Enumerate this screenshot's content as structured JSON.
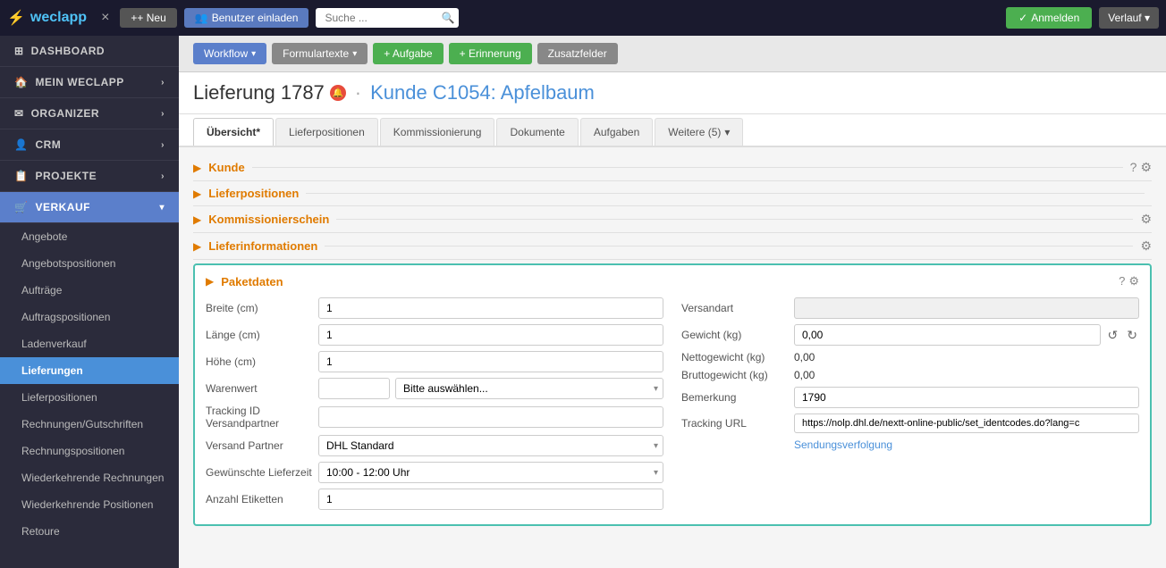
{
  "topnav": {
    "logo": "weclapp",
    "close_label": "×",
    "btn_new": "+ Neu",
    "btn_invite": "Benutzer einladen",
    "search_placeholder": "Suche ...",
    "btn_anmelden": "✓ Anmelden",
    "btn_verlauf": "Verlauf ▾"
  },
  "sidebar": {
    "items": [
      {
        "id": "dashboard",
        "label": "DASHBOARD",
        "icon": "⊞",
        "has_chevron": false
      },
      {
        "id": "mein-weclapp",
        "label": "MEIN WECLAPP",
        "icon": "🏠",
        "has_chevron": true
      },
      {
        "id": "organizer",
        "label": "ORGANIZER",
        "icon": "✉",
        "has_chevron": true
      },
      {
        "id": "crm",
        "label": "CRM",
        "icon": "👤",
        "has_chevron": true
      },
      {
        "id": "projekte",
        "label": "PROJEKTE",
        "icon": "📋",
        "has_chevron": true
      },
      {
        "id": "verkauf",
        "label": "VERKAUF",
        "icon": "🛒",
        "has_chevron": true,
        "active": true
      }
    ],
    "sub_items": [
      {
        "id": "angebote",
        "label": "Angebote"
      },
      {
        "id": "angebotspositionen",
        "label": "Angebotspositionen"
      },
      {
        "id": "auftraege",
        "label": "Aufträge"
      },
      {
        "id": "auftragspositionen",
        "label": "Auftragspositionen"
      },
      {
        "id": "ladenverkauf",
        "label": "Ladenverkauf"
      },
      {
        "id": "lieferungen",
        "label": "Lieferungen",
        "active": true
      },
      {
        "id": "lieferpositionen",
        "label": "Lieferpositionen"
      },
      {
        "id": "rechnungen-gutschriften",
        "label": "Rechnungen/Gutschriften"
      },
      {
        "id": "rechnungspositionen",
        "label": "Rechnungspositionen"
      },
      {
        "id": "wiederkehrende-rechnungen",
        "label": "Wiederkehrende Rechnungen"
      },
      {
        "id": "wiederkehrende-positionen",
        "label": "Wiederkehrende Positionen"
      },
      {
        "id": "retoure",
        "label": "Retoure"
      }
    ]
  },
  "toolbar": {
    "btn_workflow": "Workflow",
    "btn_formulartexte": "Formulartexte",
    "btn_aufgabe": "+ Aufgabe",
    "btn_erinnerung": "+ Erinnerung",
    "btn_zusatzfelder": "Zusatzfelder"
  },
  "page": {
    "title_prefix": "Lieferung 1787",
    "badge": "🔔",
    "separator": "·",
    "customer_link": "Kunde C1054: Apfelbaum"
  },
  "tabs": [
    {
      "id": "uebersicht",
      "label": "Übersicht*",
      "active": true
    },
    {
      "id": "lieferpositionen",
      "label": "Lieferpositionen"
    },
    {
      "id": "kommissionierung",
      "label": "Kommissionierung"
    },
    {
      "id": "dokumente",
      "label": "Dokumente"
    },
    {
      "id": "aufgaben",
      "label": "Aufgaben"
    },
    {
      "id": "weitere",
      "label": "Weitere (5)",
      "dropdown": true
    }
  ],
  "sections": [
    {
      "id": "kunde",
      "label": "Kunde"
    },
    {
      "id": "lieferpositionen",
      "label": "Lieferpositionen"
    },
    {
      "id": "kommissionierschein",
      "label": "Kommissionierschein",
      "has_gear": true
    },
    {
      "id": "lieferinformationen",
      "label": "Lieferinformationen",
      "has_gear": true
    }
  ],
  "paketdaten": {
    "title": "Paketdaten",
    "fields_left": [
      {
        "id": "breite",
        "label": "Breite (cm)",
        "value": "1",
        "type": "input"
      },
      {
        "id": "laenge",
        "label": "Länge (cm)",
        "value": "1",
        "type": "input"
      },
      {
        "id": "hoehe",
        "label": "Höhe (cm)",
        "value": "1",
        "type": "input"
      },
      {
        "id": "warenwert",
        "label": "Warenwert",
        "value": "",
        "type": "warenwert",
        "select_placeholder": "Bitte auswählen..."
      },
      {
        "id": "tracking-id",
        "label": "Tracking ID Versandpartner",
        "value": "",
        "type": "input"
      },
      {
        "id": "versand-partner",
        "label": "Versand Partner",
        "value": "DHL Standard",
        "type": "select"
      },
      {
        "id": "gewuenschte-lieferzeit",
        "label": "Gewünschte Lieferzeit",
        "value": "10:00 - 12:00 Uhr",
        "type": "select"
      },
      {
        "id": "anzahl-etiketten",
        "label": "Anzahl Etiketten",
        "value": "1",
        "type": "input"
      }
    ],
    "fields_right": [
      {
        "id": "versandart",
        "label": "Versandart",
        "value": "",
        "type": "input",
        "readonly": true
      },
      {
        "id": "gewicht",
        "label": "Gewicht (kg)",
        "value": "0,00",
        "type": "input-with-icons"
      },
      {
        "id": "nettogewicht",
        "label": "Nettogewicht (kg)",
        "value": "0,00",
        "type": "text"
      },
      {
        "id": "bruttogewicht",
        "label": "Bruttogewicht (kg)",
        "value": "0,00",
        "type": "text"
      },
      {
        "id": "bemerkung",
        "label": "Bemerkung",
        "value": "1790",
        "type": "input"
      },
      {
        "id": "tracking-url",
        "label": "Tracking URL",
        "value": "https://nolp.dhl.de/nextt-online-public/set_identcodes.do?lang=c",
        "type": "input"
      },
      {
        "id": "sendungsverfolgung",
        "label": "",
        "value": "Sendungsverfolgung",
        "type": "link"
      }
    ]
  }
}
